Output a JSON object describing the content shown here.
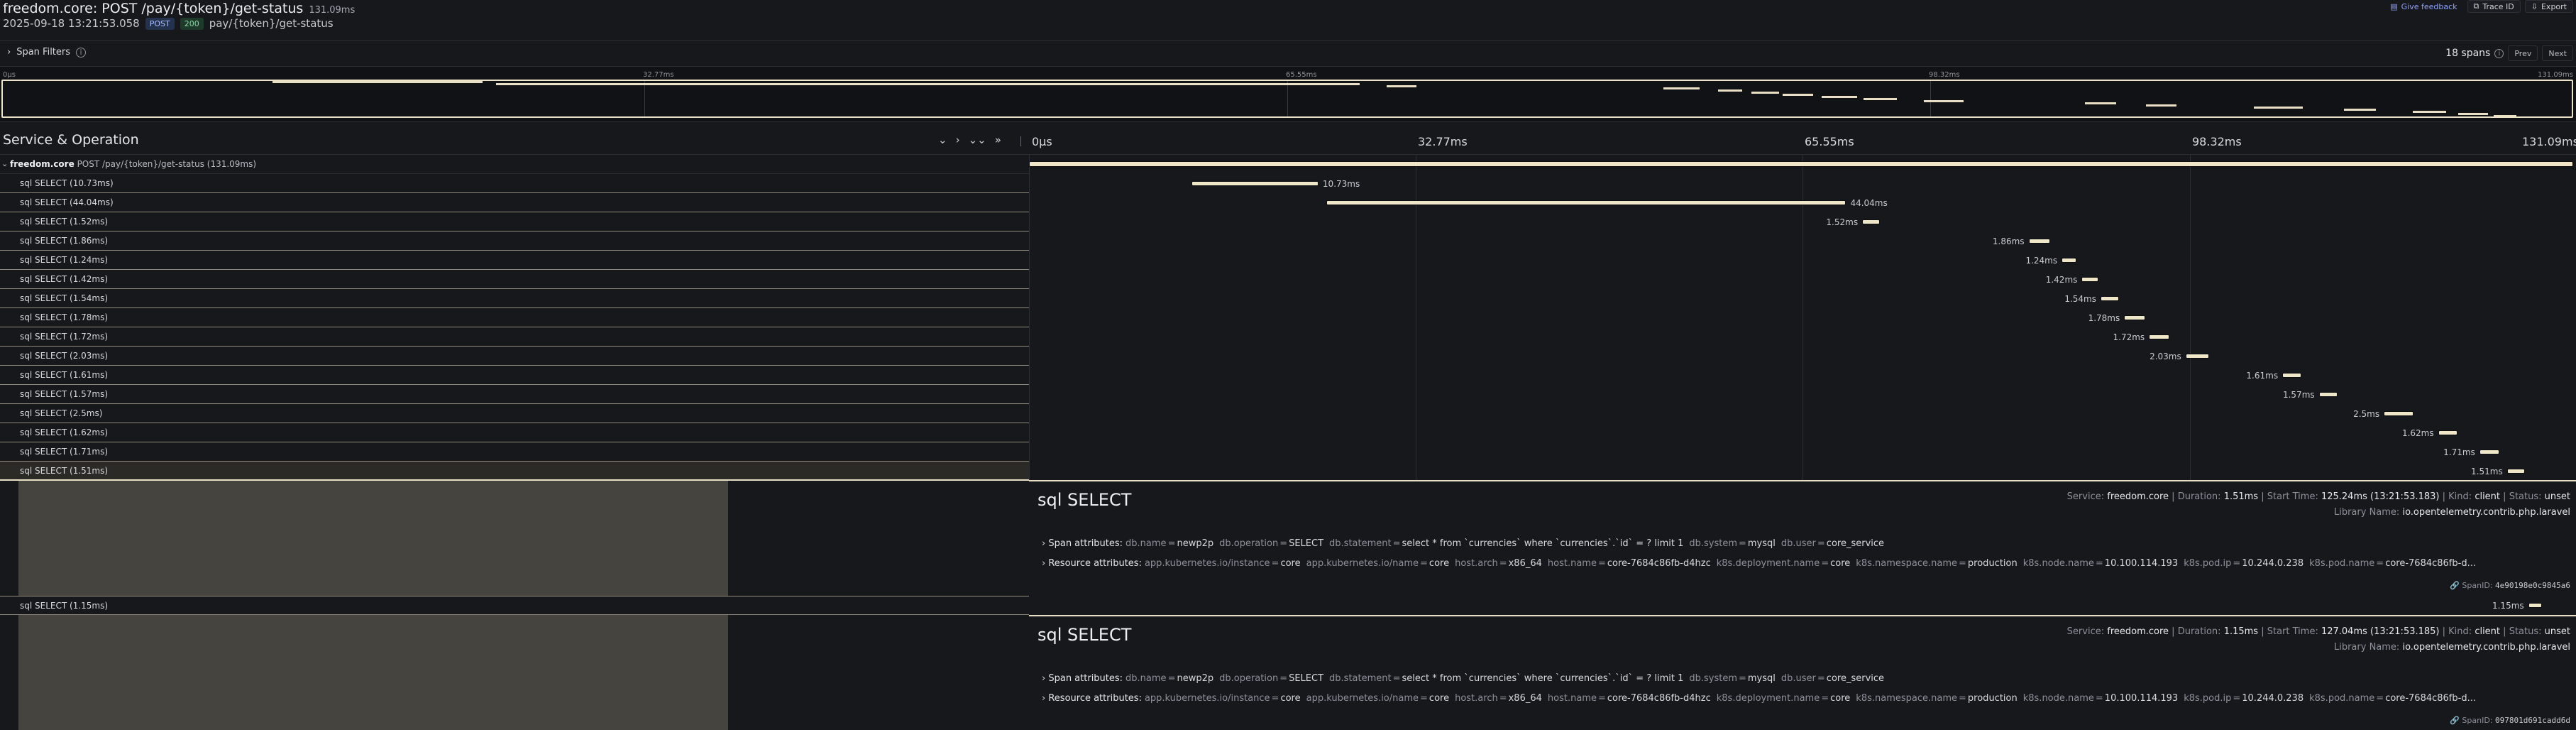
{
  "header": {
    "title": "freedom.core: POST /pay/{token}/get-status",
    "duration": "131.09ms",
    "timestamp": "2025-09-18 13:21:53.058",
    "method": "POST",
    "status": "200",
    "route": "pay/{token}/get-status",
    "feedback": "Give feedback",
    "trace_id": "Trace ID",
    "export": "Export"
  },
  "filters": {
    "label": "Span Filters",
    "count": "18 spans",
    "prev": "Prev",
    "next": "Next"
  },
  "minimap": {
    "ticks": [
      "0μs",
      "32.77ms",
      "65.55ms",
      "98.32ms",
      "131.09ms"
    ]
  },
  "columns": {
    "service_op": "Service & Operation",
    "ticks": [
      "0μs",
      "32.77ms",
      "65.55ms",
      "98.32ms",
      "131.09ms"
    ]
  },
  "total_ms": 131.09,
  "root": {
    "service": "freedom.core",
    "operation": "POST /pay/{token}/get-status (131.09ms)"
  },
  "spans": [
    {
      "label": "sql SELECT (10.73ms)",
      "start": 13.8,
      "dur": 10.73,
      "dur_label": "10.73ms"
    },
    {
      "label": "sql SELECT (44.04ms)",
      "start": 25.2,
      "dur": 44.04,
      "dur_label": "44.04ms"
    },
    {
      "label": "sql SELECT (1.52ms)",
      "start": 70.6,
      "dur": 1.52,
      "dur_label": "1.52ms"
    },
    {
      "label": "sql SELECT (1.86ms)",
      "start": 84.7,
      "dur": 1.86,
      "dur_label": "1.86ms"
    },
    {
      "label": "sql SELECT (1.24ms)",
      "start": 87.5,
      "dur": 1.24,
      "dur_label": "1.24ms"
    },
    {
      "label": "sql SELECT (1.42ms)",
      "start": 89.2,
      "dur": 1.42,
      "dur_label": "1.42ms"
    },
    {
      "label": "sql SELECT (1.54ms)",
      "start": 90.8,
      "dur": 1.54,
      "dur_label": "1.54ms"
    },
    {
      "label": "sql SELECT (1.78ms)",
      "start": 92.8,
      "dur": 1.78,
      "dur_label": "1.78ms"
    },
    {
      "label": "sql SELECT (1.72ms)",
      "start": 94.9,
      "dur": 1.72,
      "dur_label": "1.72ms"
    },
    {
      "label": "sql SELECT (2.03ms)",
      "start": 98.0,
      "dur": 2.03,
      "dur_label": "2.03ms"
    },
    {
      "label": "sql SELECT (1.61ms)",
      "start": 106.2,
      "dur": 1.61,
      "dur_label": "1.61ms"
    },
    {
      "label": "sql SELECT (1.57ms)",
      "start": 109.3,
      "dur": 1.57,
      "dur_label": "1.57ms"
    },
    {
      "label": "sql SELECT (2.5ms)",
      "start": 114.8,
      "dur": 2.5,
      "dur_label": "2.5ms"
    },
    {
      "label": "sql SELECT (1.62ms)",
      "start": 119.4,
      "dur": 1.62,
      "dur_label": "1.62ms"
    },
    {
      "label": "sql SELECT (1.71ms)",
      "start": 122.9,
      "dur": 1.71,
      "dur_label": "1.71ms"
    },
    {
      "label": "sql SELECT (1.51ms)",
      "start": 125.24,
      "dur": 1.51,
      "dur_label": "1.51ms"
    },
    {
      "label": "sql SELECT (1.15ms)",
      "start": 127.04,
      "dur": 1.15,
      "dur_label": "1.15ms"
    }
  ],
  "details": [
    {
      "name": "sql SELECT",
      "service": "freedom.core",
      "duration": "1.51ms",
      "start_time": "125.24ms (13:21:53.183)",
      "kind": "client",
      "status": "unset",
      "library": "io.opentelemetry.contrib.php.laravel",
      "span_id": "4e90198e0c9845a6",
      "span_attrs": [
        [
          "db.name",
          "newp2p"
        ],
        [
          "db.operation",
          "SELECT"
        ],
        [
          "db.statement",
          "select * from `currencies` where `currencies`.`id` = ? limit 1"
        ],
        [
          "db.system",
          "mysql"
        ],
        [
          "db.user",
          "core_service"
        ]
      ],
      "res_attrs": [
        [
          "app.kubernetes.io/instance",
          "core"
        ],
        [
          "app.kubernetes.io/name",
          "core"
        ],
        [
          "host.arch",
          "x86_64"
        ],
        [
          "host.name",
          "core-7684c86fb-d4hzc"
        ],
        [
          "k8s.deployment.name",
          "core"
        ],
        [
          "k8s.namespace.name",
          "production"
        ],
        [
          "k8s.node.name",
          "10.100.114.193"
        ],
        [
          "k8s.pod.ip",
          "10.244.0.238"
        ],
        [
          "k8s.pod.name",
          "core-7684c86fb-d..."
        ]
      ]
    },
    {
      "name": "sql SELECT",
      "service": "freedom.core",
      "duration": "1.15ms",
      "start_time": "127.04ms (13:21:53.185)",
      "kind": "client",
      "status": "unset",
      "library": "io.opentelemetry.contrib.php.laravel",
      "span_id": "097801d691cadd6d",
      "span_attrs": [
        [
          "db.name",
          "newp2p"
        ],
        [
          "db.operation",
          "SELECT"
        ],
        [
          "db.statement",
          "select * from `currencies` where `currencies`.`id` = ? limit 1"
        ],
        [
          "db.system",
          "mysql"
        ],
        [
          "db.user",
          "core_service"
        ]
      ],
      "res_attrs": [
        [
          "app.kubernetes.io/instance",
          "core"
        ],
        [
          "app.kubernetes.io/name",
          "core"
        ],
        [
          "host.arch",
          "x86_64"
        ],
        [
          "host.name",
          "core-7684c86fb-d4hzc"
        ],
        [
          "k8s.deployment.name",
          "core"
        ],
        [
          "k8s.namespace.name",
          "production"
        ],
        [
          "k8s.node.name",
          "10.100.114.193"
        ],
        [
          "k8s.pod.ip",
          "10.244.0.238"
        ],
        [
          "k8s.pod.name",
          "core-7684c86fb-d..."
        ]
      ]
    }
  ],
  "labels": {
    "span_attributes": "Span attributes:",
    "resource_attributes": "Resource attributes:",
    "service": "Service:",
    "duration": "Duration:",
    "start_time": "Start Time:",
    "kind": "Kind:",
    "status": "Status:",
    "library": "Library Name:",
    "span_id": "SpanID:"
  }
}
